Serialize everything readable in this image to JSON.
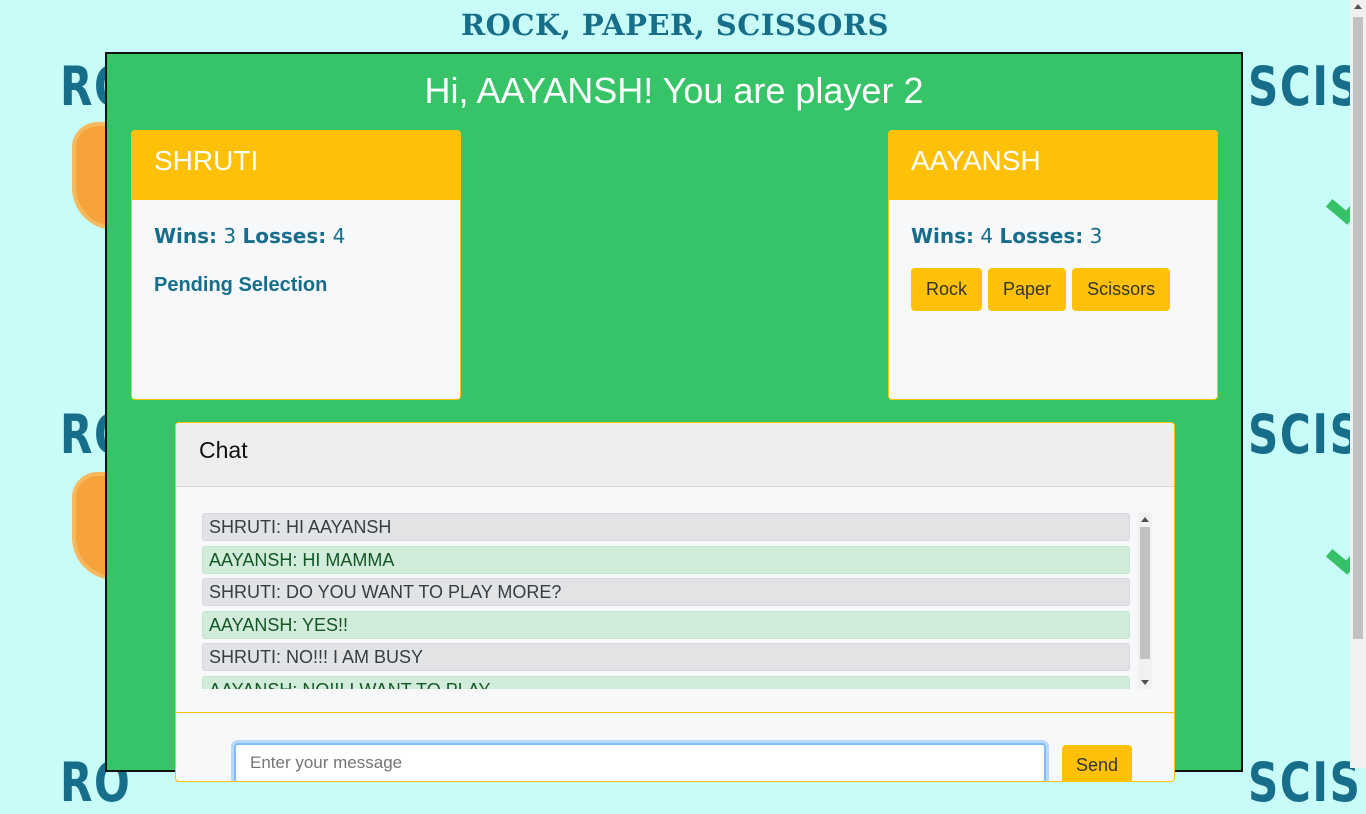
{
  "site": {
    "title": "ROCK, PAPER, SCISSORS"
  },
  "background": {
    "word_left": "RO",
    "word_right": "SCIS"
  },
  "game": {
    "greeting": "Hi, AAYANSH! You are player 2",
    "player1": {
      "name": "SHRUTI",
      "wins_label": "Wins:",
      "wins": "3",
      "losses_label": "Losses:",
      "losses": "4",
      "status": "Pending Selection"
    },
    "player2": {
      "name": "AAYANSH",
      "wins_label": "Wins:",
      "wins": "4",
      "losses_label": "Losses:",
      "losses": "3",
      "choices": [
        "Rock",
        "Paper",
        "Scissors"
      ]
    }
  },
  "chat": {
    "title": "Chat",
    "messages": [
      {
        "text": "SHRUTI: HI AAYANSH",
        "from": "player1"
      },
      {
        "text": "AAYANSH: HI MAMMA",
        "from": "player2"
      },
      {
        "text": "SHRUTI: DO YOU WANT TO PLAY MORE?",
        "from": "player1"
      },
      {
        "text": "AAYANSH: YES!!",
        "from": "player2"
      },
      {
        "text": "SHRUTI: NO!!! I AM BUSY",
        "from": "player1"
      },
      {
        "text": "AAYANSH: NO!!! I WANT TO PLAY",
        "from": "player2"
      }
    ],
    "input_placeholder": "Enter your message",
    "input_value": "",
    "send_label": "Send"
  },
  "colors": {
    "background": "#c8fcf8",
    "panel": "#37c468",
    "accent": "#ffc107",
    "text_blue": "#166e8a"
  }
}
